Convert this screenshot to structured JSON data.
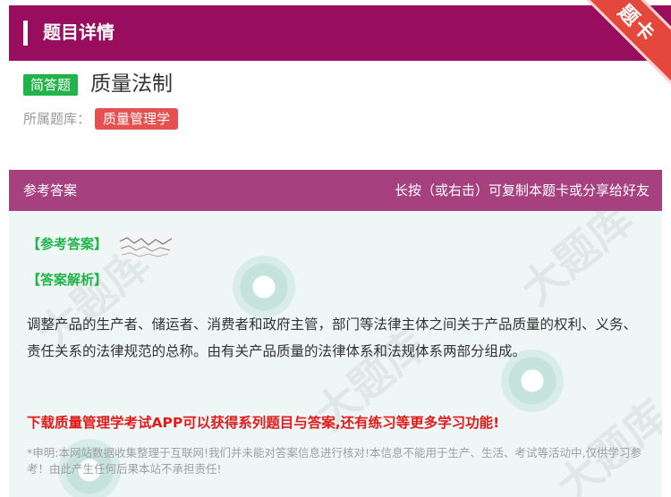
{
  "header": {
    "title": "题目详情",
    "corner_label": "题卡"
  },
  "question": {
    "type_badge": "简答题",
    "title": "质量法制",
    "bank_label": "所属题库：",
    "bank_name": "质量管理学"
  },
  "answer_section": {
    "header_left": "参考答案",
    "header_right": "长按（或右击）可复制本题卡或分享给好友",
    "ref_answer_label": "【参考答案】",
    "analysis_label": "【答案解析】",
    "analysis_text": "调整产品的生产者、储运者、消费者和政府主管，部门等法律主体之间关于产品质量的权利、义务、责任关系的法律规范的总称。由有关产品质量的法律体系和法规体系两部分组成。",
    "promo": "下载质量管理学考试APP可以获得系列题目与答案,还有练习等更多学习功能!",
    "disclaimer": "*申明:本网站数据收集整理于互联网!我们并未能对答案信息进行核对!本信息不能用于生产、生活、考试等活动中,仅供学习参考！由此产生任何后果本站不承担责任!"
  },
  "colors": {
    "header_bg": "#980d5e",
    "answer_header_bg": "#a7407e",
    "badge_green": "#22b34a",
    "tag_red": "#e55050",
    "promo_red": "#e21a1a"
  },
  "icons": {
    "answer_image": "blurred-answer-image"
  }
}
